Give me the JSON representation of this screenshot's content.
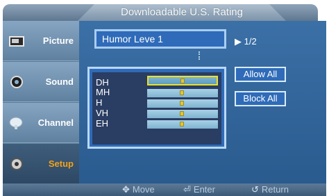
{
  "header": {
    "title": "Downloadable  U.S. Rating"
  },
  "sidebar": {
    "items": [
      {
        "label": "Picture",
        "icon": "picture-icon"
      },
      {
        "label": "Sound",
        "icon": "sound-icon"
      },
      {
        "label": "Channel",
        "icon": "channel-icon"
      },
      {
        "label": "Setup",
        "icon": "setup-icon",
        "active": true
      }
    ]
  },
  "rating": {
    "selected": "Humor  Leve 1",
    "page": "1/2",
    "rows": [
      "DH",
      "MH",
      "H",
      "VH",
      "EH"
    ]
  },
  "actions": {
    "allow_all": "Allow All",
    "block_all": "Block All"
  },
  "footer": {
    "move": "Move",
    "enter": "Enter",
    "return": "Return"
  },
  "colors": {
    "accent": "#f2a21b",
    "panel": "#2f6bb8",
    "selected_cell_border": "#e9e12b"
  }
}
